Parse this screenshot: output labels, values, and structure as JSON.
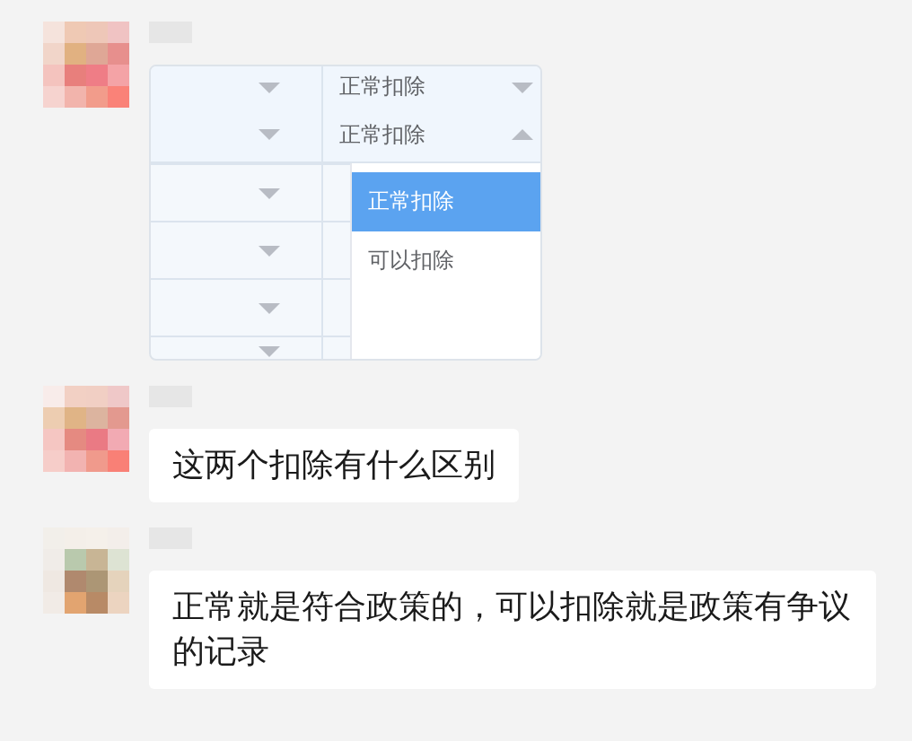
{
  "messages": [
    {
      "table": {
        "rows": [
          {
            "value": "正常扣除",
            "expanded": false
          },
          {
            "value": "正常扣除",
            "expanded": true
          },
          {},
          {},
          {},
          {}
        ]
      },
      "dropdown": {
        "options": [
          {
            "label": "正常扣除",
            "selected": true
          },
          {
            "label": "可以扣除",
            "selected": false
          }
        ]
      }
    },
    {
      "kind": "text",
      "text": "这两个扣除有什么区别"
    },
    {
      "kind": "text",
      "text": "正常就是符合政策的，可以扣除就是政策有争议的记录"
    }
  ]
}
